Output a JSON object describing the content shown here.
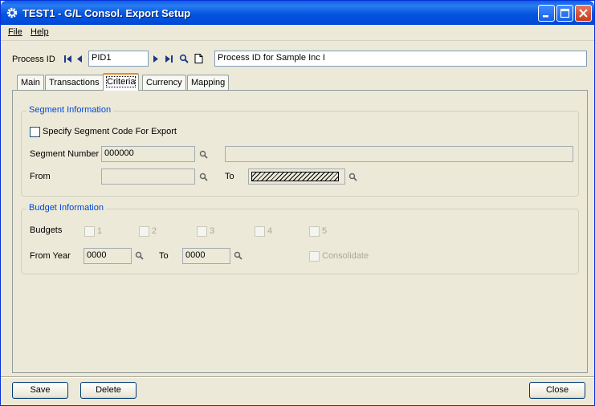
{
  "window": {
    "title": "TEST1 - G/L Consol. Export Setup"
  },
  "menu": {
    "file": "File",
    "help": "Help"
  },
  "process": {
    "label": "Process ID",
    "value": "PID1",
    "description": "Process ID for Sample Inc I"
  },
  "tabs": [
    {
      "label": "Main"
    },
    {
      "label": "Transactions"
    },
    {
      "label": "Criteria"
    },
    {
      "label": "Currency"
    },
    {
      "label": "Mapping"
    }
  ],
  "active_tab": "Criteria",
  "segment": {
    "group_title": "Segment Information",
    "specify_label": "Specify Segment Code For Export",
    "specify_checked": false,
    "number_label": "Segment Number",
    "number_value": "000000",
    "number_desc": "",
    "from_label": "From",
    "from_value": "",
    "to_label": "To",
    "to_value": ""
  },
  "budget": {
    "group_title": "Budget Information",
    "budgets_label": "Budgets",
    "options": [
      "1",
      "2",
      "3",
      "4",
      "5"
    ],
    "from_year_label": "From Year",
    "from_year_value": "0000",
    "to_label": "To",
    "to_value": "0000",
    "consolidate_label": "Consolidate"
  },
  "buttons": {
    "save": "Save",
    "delete": "Delete",
    "close": "Close"
  },
  "colors": {
    "title_bar": "#0355e0",
    "group_title": "#0046d5",
    "active_tab_accent": "#e68b2c"
  },
  "icons": [
    "gear-icon",
    "first-icon",
    "prev-icon",
    "next-icon",
    "last-icon",
    "search-icon",
    "new-document-icon",
    "minimize-icon",
    "maximize-icon",
    "close-icon"
  ]
}
